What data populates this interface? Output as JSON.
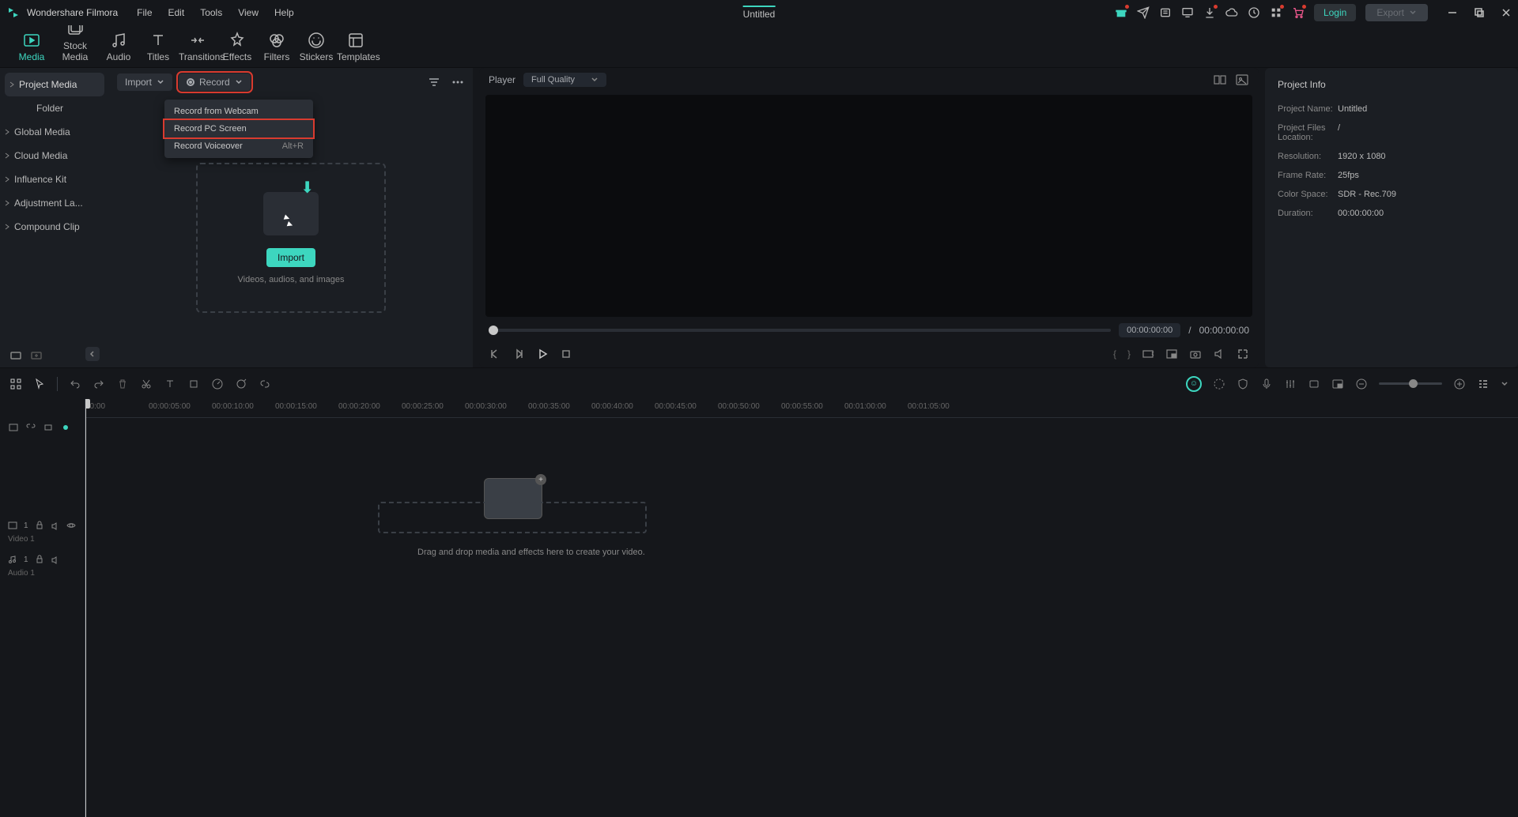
{
  "app_name": "Wondershare Filmora",
  "menus": [
    "File",
    "Edit",
    "Tools",
    "View",
    "Help"
  ],
  "doc_title": "Untitled",
  "login_label": "Login",
  "export_label": "Export",
  "tool_tabs": [
    {
      "id": "media",
      "label": "Media"
    },
    {
      "id": "stock",
      "label": "Stock Media"
    },
    {
      "id": "audio",
      "label": "Audio"
    },
    {
      "id": "titles",
      "label": "Titles"
    },
    {
      "id": "transitions",
      "label": "Transitions"
    },
    {
      "id": "effects",
      "label": "Effects"
    },
    {
      "id": "filters",
      "label": "Filters"
    },
    {
      "id": "stickers",
      "label": "Stickers"
    },
    {
      "id": "templates",
      "label": "Templates"
    }
  ],
  "sidebar": {
    "project": "Project Media",
    "folder": "Folder",
    "items": [
      "Global Media",
      "Cloud Media",
      "Influence Kit",
      "Adjustment La...",
      "Compound Clip"
    ]
  },
  "media_toolbar": {
    "import": "Import",
    "record": "Record"
  },
  "record_menu": [
    {
      "label": "Record from Webcam",
      "shortcut": ""
    },
    {
      "label": "Record PC Screen",
      "shortcut": ""
    },
    {
      "label": "Record Voiceover",
      "shortcut": "Alt+R"
    }
  ],
  "dropzone": {
    "import": "Import",
    "hint": "Videos, audios, and images"
  },
  "player": {
    "label": "Player",
    "quality": "Full Quality",
    "cur": "00:00:00:00",
    "sep": "/",
    "dur": "00:00:00:00"
  },
  "info": {
    "title": "Project Info",
    "rows": [
      {
        "label": "Project Name:",
        "val": "Untitled"
      },
      {
        "label": "Project Files Location:",
        "val": "/"
      },
      {
        "label": "Resolution:",
        "val": "1920 x 1080"
      },
      {
        "label": "Frame Rate:",
        "val": "25fps"
      },
      {
        "label": "Color Space:",
        "val": "SDR - Rec.709"
      },
      {
        "label": "Duration:",
        "val": "00:00:00:00"
      }
    ]
  },
  "ruler": [
    "00:00",
    "00:00:05:00",
    "00:00:10:00",
    "00:00:15:00",
    "00:00:20:00",
    "00:00:25:00",
    "00:00:30:00",
    "00:00:35:00",
    "00:00:40:00",
    "00:00:45:00",
    "00:00:50:00",
    "00:00:55:00",
    "00:01:00:00",
    "00:01:05:00"
  ],
  "tracks": {
    "video": "Video 1",
    "audio": "Audio 1"
  },
  "tl_hint": "Drag and drop media and effects here to create your video."
}
